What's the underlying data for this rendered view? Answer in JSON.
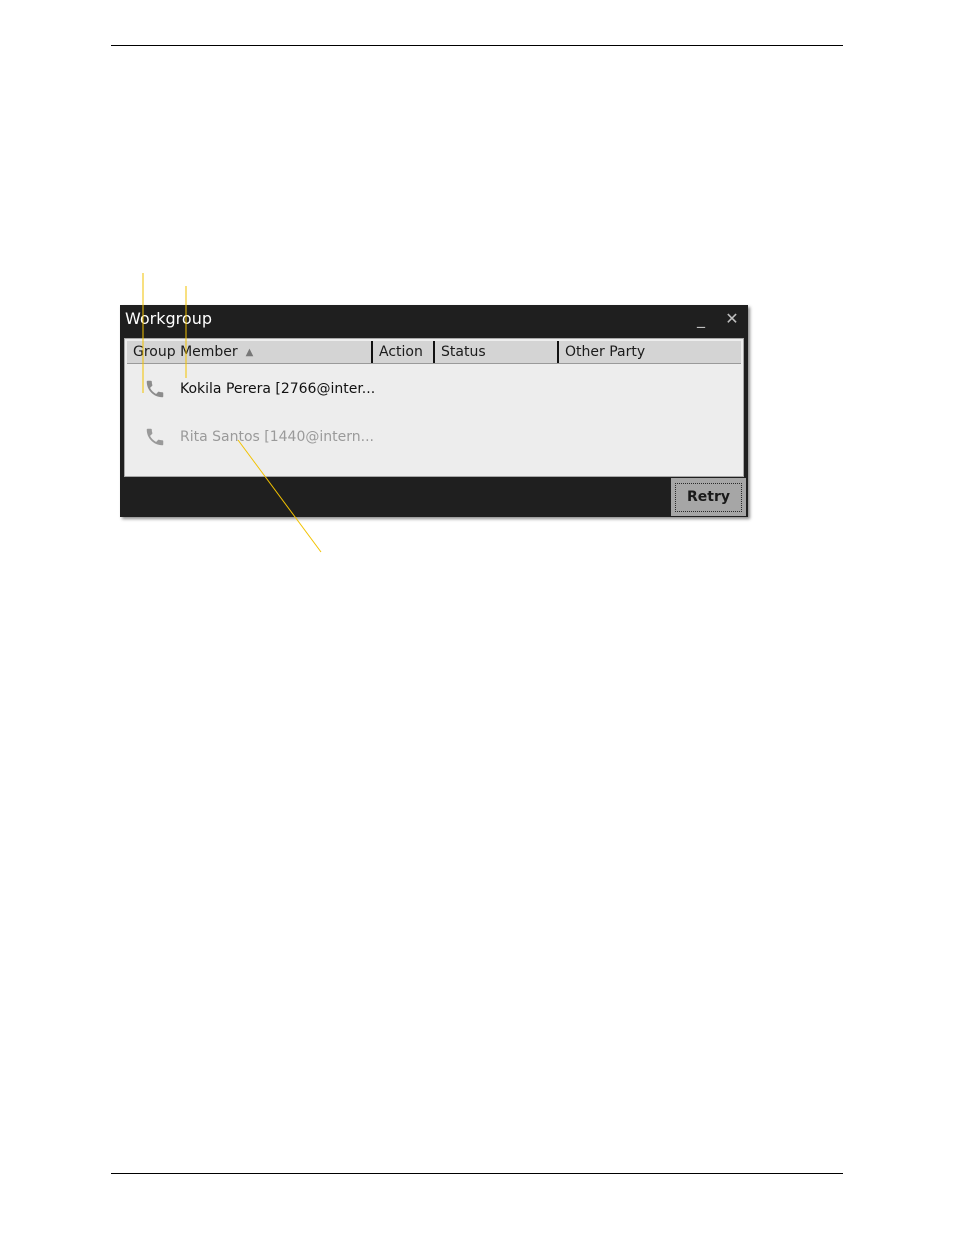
{
  "window": {
    "title": "Workgroup",
    "minimize_glyph": "_",
    "close_glyph": "✕"
  },
  "table": {
    "columns": [
      {
        "label": "Group Member",
        "sorted": "ascending"
      },
      {
        "label": "Action"
      },
      {
        "label": "Status"
      },
      {
        "label": "Other Party"
      }
    ],
    "rows": [
      {
        "name": "Kokila Perera [2766@inter...",
        "icon": "phone-icon",
        "state": "active"
      },
      {
        "name": "Rita Santos [1440@intern...",
        "icon": "phone-icon",
        "state": "inactive"
      }
    ]
  },
  "footer": {
    "retry_label": "Retry"
  },
  "colors": {
    "window_bg": "#1f1f1f",
    "panel_bg": "#ededed",
    "header_bg": "#d4d4d4",
    "callout_line": "#f2c200",
    "button_bg": "#a6a6a6"
  }
}
